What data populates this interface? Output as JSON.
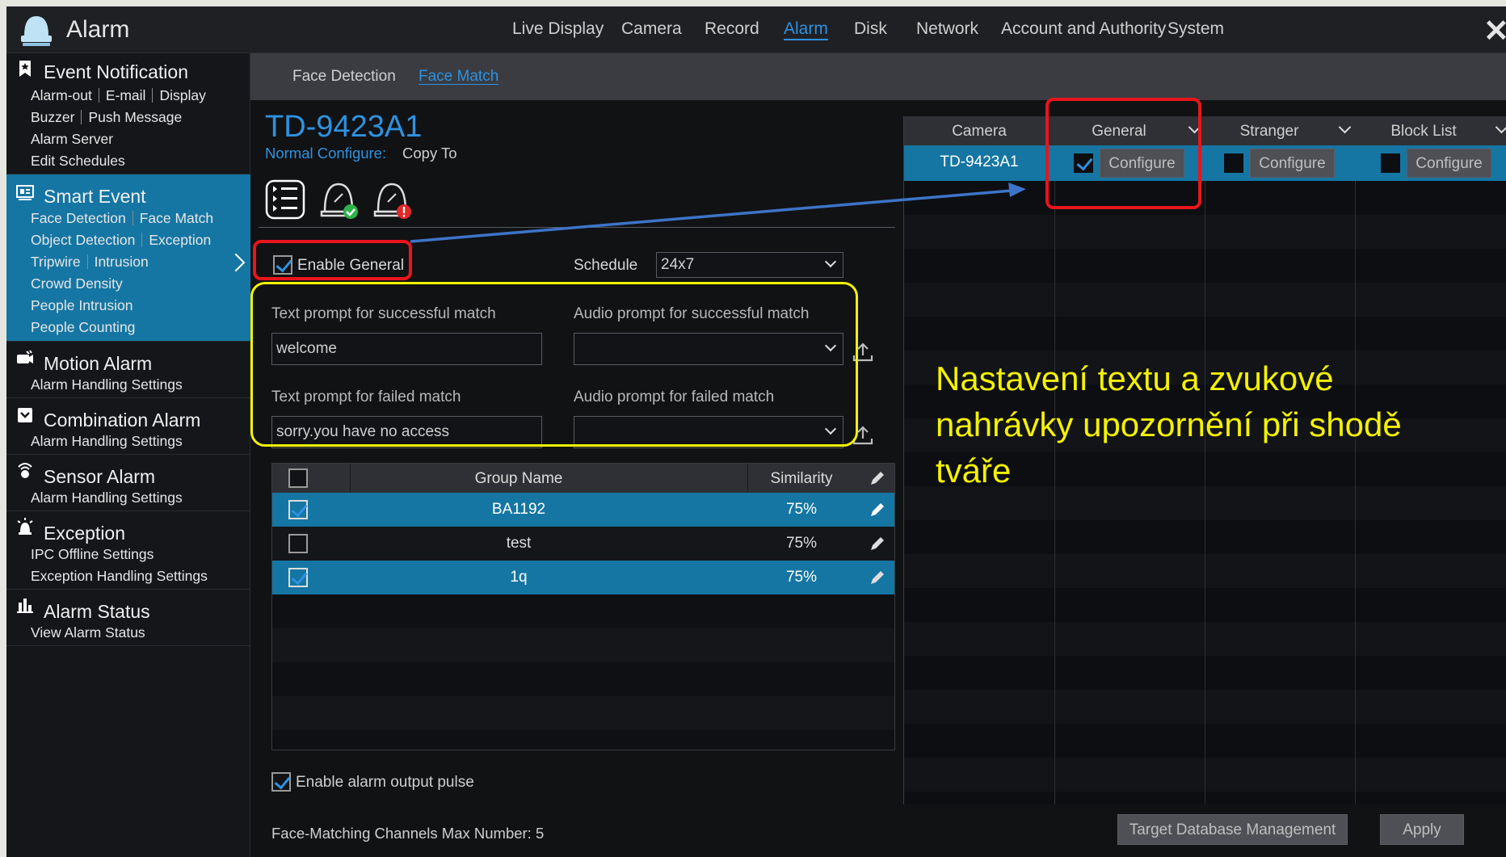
{
  "app": {
    "title": "Alarm"
  },
  "nav": [
    "Live Display",
    "Camera",
    "Record",
    "Alarm",
    "Disk",
    "Network",
    "Account and Authority",
    "System"
  ],
  "sidebar": {
    "event_notification": {
      "title": "Event Notification",
      "items": [
        "Alarm-out",
        "E-mail",
        "Display",
        "Buzzer",
        "Push Message",
        "Alarm Server",
        "Edit Schedules"
      ]
    },
    "smart_event": {
      "title": "Smart Event",
      "items": [
        "Face Detection",
        "Face Match",
        "Object Detection",
        "Exception",
        "Tripwire",
        "Intrusion",
        "Crowd Density",
        "People Intrusion",
        "People Counting"
      ]
    },
    "motion_alarm": {
      "title": "Motion Alarm",
      "sub": "Alarm Handling Settings"
    },
    "combination_alarm": {
      "title": "Combination Alarm",
      "sub": "Alarm Handling Settings"
    },
    "sensor_alarm": {
      "title": "Sensor Alarm",
      "sub": "Alarm Handling Settings"
    },
    "exception": {
      "title": "Exception",
      "items": [
        "IPC Offline Settings",
        "Exception Handling Settings"
      ]
    },
    "alarm_status": {
      "title": "Alarm Status",
      "sub": "View Alarm Status"
    }
  },
  "subtabs": [
    "Face Detection",
    "Face Match"
  ],
  "device": {
    "name": "TD-9423A1",
    "configure_label": "Normal Configure:",
    "copy_label": "Copy To"
  },
  "form": {
    "enable_general": "Enable General",
    "schedule_label": "Schedule",
    "schedule_value": "24x7",
    "text_success_label": "Text prompt for successful match",
    "text_success_value": "welcome",
    "audio_success_label": "Audio prompt for successful match",
    "text_failed_label": "Text prompt for failed match",
    "text_failed_value": "sorry.you have no access",
    "audio_failed_label": "Audio prompt for failed match",
    "enable_pulse": "Enable alarm output pulse",
    "max_number": "Face-Matching Channels Max Number: 5"
  },
  "group_table": {
    "headers": [
      "Group Name",
      "Similarity"
    ],
    "rows": [
      {
        "name": "BA1192",
        "similarity": "75%"
      },
      {
        "name": "test",
        "similarity": "75%"
      },
      {
        "name": "1q",
        "similarity": "75%"
      }
    ]
  },
  "camera_table": {
    "headers": [
      "Camera",
      "General",
      "Stranger",
      "Block List"
    ],
    "row": {
      "camera": "TD-9423A1",
      "configure": "Configure"
    }
  },
  "annotation": "Nastavení textu a zvukové nahrávky upozornění při shodě tváře",
  "buttons": {
    "target_db": "Target Database Management",
    "apply": "Apply"
  },
  "colors": {
    "accent": "#2e92e0",
    "selected_row": "#1576a3",
    "highlight_red": "#e8151b",
    "highlight_yellow": "#f4f200"
  }
}
